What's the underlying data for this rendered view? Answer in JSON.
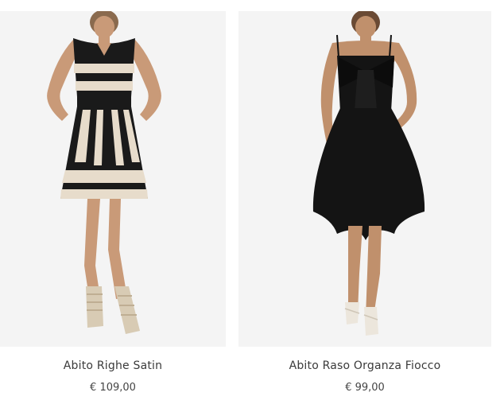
{
  "products": [
    {
      "name": "Abito Righe Satin",
      "price": "€ 109,00",
      "image_icon": "striped-satin-dress-photo"
    },
    {
      "name": "Abito Raso Organza Fiocco",
      "price": "€ 99,00",
      "image_icon": "black-bow-dress-photo"
    }
  ],
  "colors": {
    "photo_background": "#f3f3f3",
    "text": "#3a3a3a"
  }
}
